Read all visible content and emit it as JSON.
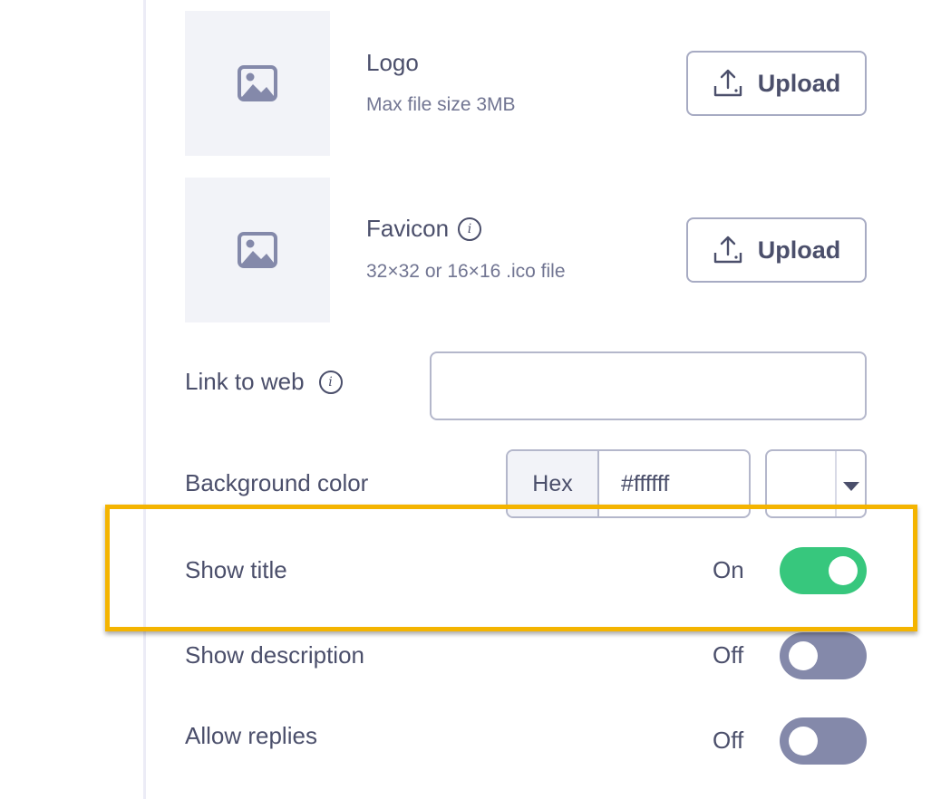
{
  "logo": {
    "title": "Logo",
    "subtitle": "Max file size 3MB",
    "upload_label": "Upload"
  },
  "favicon": {
    "title": "Favicon",
    "subtitle": "32×32 or 16×16 .ico file",
    "upload_label": "Upload"
  },
  "link_to_web": {
    "label": "Link to web",
    "value": "",
    "placeholder": ""
  },
  "background_color": {
    "label": "Background color",
    "format": "Hex",
    "value": "#ffffff",
    "swatch_color": "#ffffff"
  },
  "toggles": [
    {
      "label": "Show title",
      "state": "On",
      "on": true
    },
    {
      "label": "Show description",
      "state": "Off",
      "on": false
    },
    {
      "label": "Allow replies",
      "state": "Off",
      "on": false
    }
  ],
  "colors": {
    "toggle_on": "#37c77d",
    "toggle_off": "#8489aa",
    "highlight": "#f4b400",
    "text": "#4b4f6b"
  },
  "icons": {
    "thumbnail": "image-placeholder-icon",
    "upload": "upload-icon",
    "info": "info-icon",
    "dropdown": "caret-down-icon"
  }
}
